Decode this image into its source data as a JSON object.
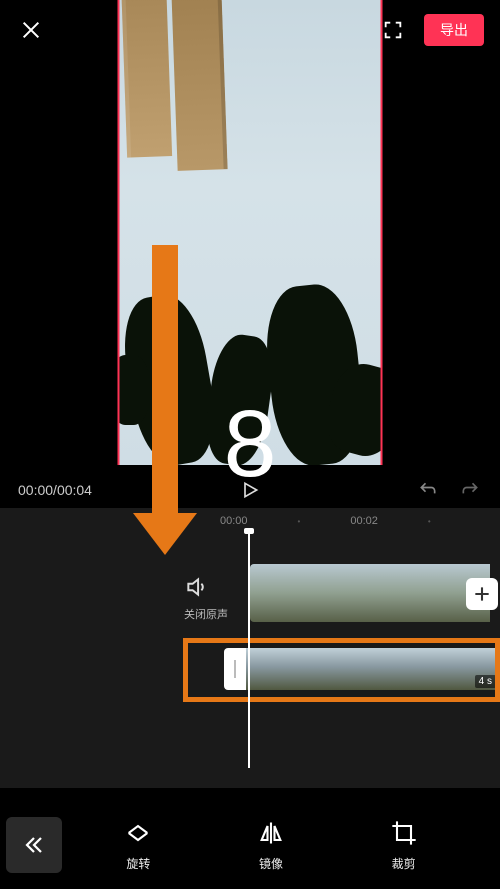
{
  "header": {
    "export_label": "导出"
  },
  "preview": {
    "overlay_number": "8"
  },
  "player": {
    "current_time": "00:00",
    "total_time": "00:04"
  },
  "timeline": {
    "ruler_ticks": [
      "00:00",
      "00:02"
    ],
    "mute_label": "关闭原声",
    "clip2_duration": "4 s"
  },
  "toolbar": {
    "rotate_label": "旋转",
    "mirror_label": "镜像",
    "crop_label": "裁剪"
  },
  "icons": {
    "close": "close-icon",
    "fullscreen": "fullscreen-icon",
    "play": "play-icon",
    "undo": "undo-icon",
    "redo": "redo-icon",
    "mute": "mute-icon",
    "plus": "plus-icon",
    "collapse": "chevrons-left-icon",
    "rotate": "rotate-icon",
    "mirror": "mirror-icon",
    "crop": "crop-icon"
  },
  "colors": {
    "accent": "#ff3355",
    "annotation": "#e67817"
  }
}
